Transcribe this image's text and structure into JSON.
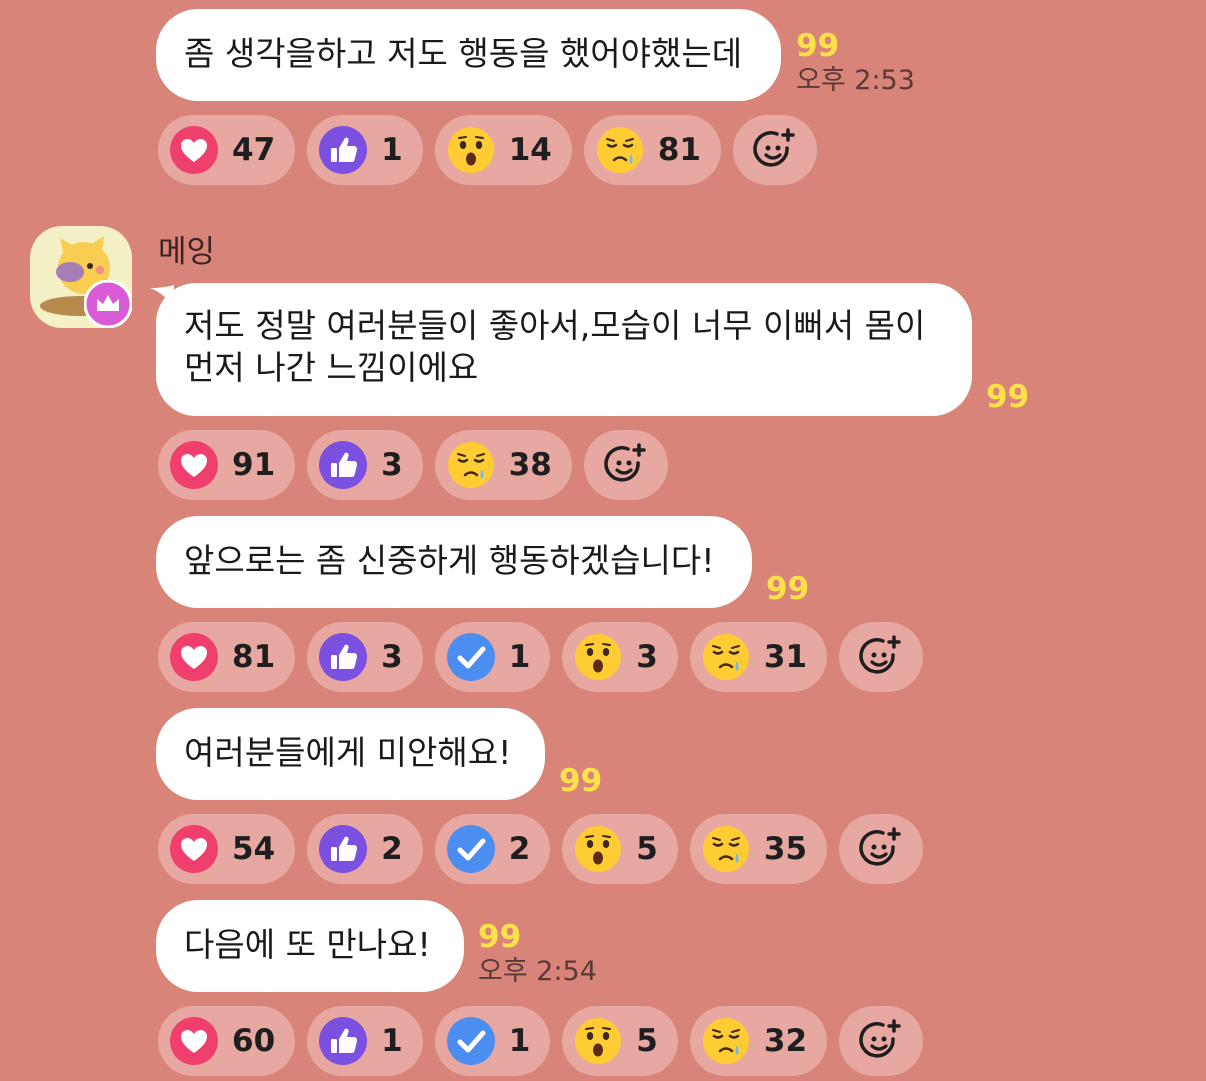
{
  "sender": {
    "name": "메잉"
  },
  "messages": [
    {
      "text": "좀 생각을하고 저도 행동을 했어야했는데",
      "unread": "99",
      "time": "오후 2:53",
      "reactions": [
        {
          "icon": "heart-icon",
          "count": "47"
        },
        {
          "icon": "thumbs-up-icon",
          "count": "1"
        },
        {
          "icon": "surprised-face-icon",
          "count": "14"
        },
        {
          "icon": "sad-face-icon",
          "count": "81"
        }
      ]
    },
    {
      "text": "저도 정말 여러분들이 좋아서,모습이 너무 이뻐서 몸이 먼저 나간 느낌이에요",
      "unread": "99",
      "time": "",
      "reactions": [
        {
          "icon": "heart-icon",
          "count": "91"
        },
        {
          "icon": "thumbs-up-icon",
          "count": "3"
        },
        {
          "icon": "sad-face-icon",
          "count": "38"
        }
      ]
    },
    {
      "text": "앞으로는 좀 신중하게 행동하겠습니다!",
      "unread": "99",
      "time": "",
      "reactions": [
        {
          "icon": "heart-icon",
          "count": "81"
        },
        {
          "icon": "thumbs-up-icon",
          "count": "3"
        },
        {
          "icon": "check-icon",
          "count": "1"
        },
        {
          "icon": "surprised-face-icon",
          "count": "3"
        },
        {
          "icon": "sad-face-icon",
          "count": "31"
        }
      ]
    },
    {
      "text": "여러분들에게 미안해요!",
      "unread": "99",
      "time": "",
      "reactions": [
        {
          "icon": "heart-icon",
          "count": "54"
        },
        {
          "icon": "thumbs-up-icon",
          "count": "2"
        },
        {
          "icon": "check-icon",
          "count": "2"
        },
        {
          "icon": "surprised-face-icon",
          "count": "5"
        },
        {
          "icon": "sad-face-icon",
          "count": "35"
        }
      ]
    },
    {
      "text": "다음에 또 만나요!",
      "unread": "99",
      "time": "오후 2:54",
      "reactions": [
        {
          "icon": "heart-icon",
          "count": "60"
        },
        {
          "icon": "thumbs-up-icon",
          "count": "1"
        },
        {
          "icon": "check-icon",
          "count": "1"
        },
        {
          "icon": "surprised-face-icon",
          "count": "5"
        },
        {
          "icon": "sad-face-icon",
          "count": "32"
        }
      ]
    }
  ],
  "colors": {
    "background": "#d98479",
    "pill": "#e6a8a0",
    "unread": "#ffe24a",
    "heart": "#ef3f6d",
    "thumb": "#7b4fe0",
    "check": "#4c8df0",
    "face": "#ffcc33",
    "crown": "#d95bd6"
  }
}
